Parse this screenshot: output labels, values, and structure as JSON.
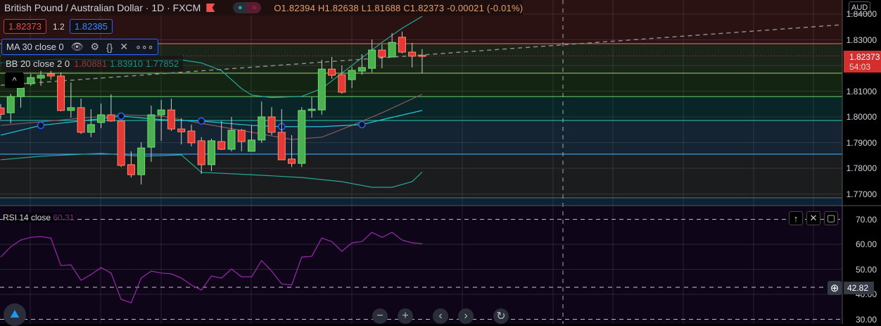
{
  "header": {
    "symbol": "British Pound / Australian Dollar · 1D · FXCM",
    "open": "O1.82394",
    "high": "H1.82638",
    "low": "L1.81688",
    "close": "C1.82373",
    "change": "-0.00021 (-0.01%)"
  },
  "quote": {
    "sell": "1.82373",
    "spread": "1.2",
    "buy": "1.82385"
  },
  "ma_legend": {
    "label": "MA 30 close 0"
  },
  "bb_legend": {
    "label": "BB 20 close 2 0",
    "basis": "1.80881",
    "upper": "1.83910",
    "lower": "1.77852"
  },
  "rsi_legend": {
    "label": "RSI 14 close",
    "value": "60.31"
  },
  "axis": {
    "currency": "AUD",
    "price_ticks": [
      "1.84000",
      "1.83000",
      "1.82000",
      "1.81000",
      "1.80000",
      "1.79000",
      "1.78000",
      "1.77000"
    ],
    "last_price": "1.82373",
    "countdown": "54:03",
    "rsi_ticks": [
      "70.00",
      "60.00",
      "50.00",
      "40.00",
      "30.00"
    ],
    "crosshair_rsi": "42.82"
  },
  "colors": {
    "up": "#4caf50",
    "down": "#e53935",
    "ma": "#26c6da",
    "bb": "#26a69a",
    "basis": "#8d5a5a",
    "rsi": "#9c27b0"
  },
  "chart_data": {
    "type": "candlestick",
    "ohlc": [
      [
        1.8035,
        1.805,
        1.799,
        1.801
      ],
      [
        1.8016,
        1.809,
        1.7975,
        1.8079
      ],
      [
        1.8079,
        1.8121,
        1.8036,
        1.8112
      ],
      [
        1.8129,
        1.8167,
        1.8121,
        1.8153
      ],
      [
        1.8151,
        1.8181,
        1.8121,
        1.8162
      ],
      [
        1.8167,
        1.8181,
        1.8145,
        1.8159
      ],
      [
        1.8159,
        1.8173,
        1.8022,
        1.8025
      ],
      [
        1.8025,
        1.8134,
        1.7997,
        1.8036
      ],
      [
        1.8036,
        1.8071,
        1.7934,
        1.794
      ],
      [
        1.794,
        1.803,
        1.7921,
        1.797
      ],
      [
        1.7978,
        1.8052,
        1.7956,
        1.8008
      ],
      [
        1.8008,
        1.8088,
        1.7981,
        1.7984
      ],
      [
        1.7984,
        1.7986,
        1.7805,
        1.7811
      ],
      [
        1.7814,
        1.7866,
        1.7764,
        1.7775
      ],
      [
        1.7775,
        1.7901,
        1.7737,
        1.7879
      ],
      [
        1.7882,
        1.8044,
        1.7825,
        1.8008
      ],
      [
        1.8008,
        1.8066,
        1.7907,
        1.8027
      ],
      [
        1.8027,
        1.8071,
        1.7945,
        1.7953
      ],
      [
        1.7953,
        1.7995,
        1.7893,
        1.7942
      ],
      [
        1.7945,
        1.797,
        1.7885,
        1.7899
      ],
      [
        1.7907,
        1.7921,
        1.7778,
        1.7814
      ],
      [
        1.7814,
        1.7915,
        1.7789,
        1.7907
      ],
      [
        1.7904,
        1.7984,
        1.7871,
        1.7874
      ],
      [
        1.7874,
        1.8,
        1.7866,
        1.7948
      ],
      [
        1.7948,
        1.7953,
        1.7866,
        1.7904
      ],
      [
        1.7866,
        1.7967,
        1.7866,
        1.791
      ],
      [
        1.791,
        1.806,
        1.7899,
        1.8
      ],
      [
        1.8,
        1.8038,
        1.7929,
        1.794
      ],
      [
        1.794,
        1.803,
        1.7833,
        1.7833
      ],
      [
        1.7836,
        1.7929,
        1.7805,
        1.7819
      ],
      [
        1.7819,
        1.8038,
        1.7805,
        1.8025
      ],
      [
        1.8025,
        1.8077,
        1.7997,
        1.803
      ],
      [
        1.8027,
        1.8222,
        1.8008,
        1.8186
      ],
      [
        1.8186,
        1.8233,
        1.8148,
        1.8162
      ],
      [
        1.8164,
        1.82,
        1.809,
        1.8096
      ],
      [
        1.8145,
        1.8195,
        1.8112,
        1.8181
      ],
      [
        1.8178,
        1.8244,
        1.8164,
        1.8192
      ],
      [
        1.8189,
        1.8301,
        1.8173,
        1.826
      ],
      [
        1.826,
        1.8282,
        1.8189,
        1.8233
      ],
      [
        1.8233,
        1.8326,
        1.8233,
        1.829
      ],
      [
        1.831,
        1.8332,
        1.8247,
        1.8252
      ],
      [
        1.8252,
        1.8288,
        1.8192,
        1.8236
      ],
      [
        1.82394,
        1.82638,
        1.81688,
        1.82373
      ]
    ],
    "bb_upper": [
      [
        0,
        1.821
      ],
      [
        6,
        1.8225
      ],
      [
        12,
        1.822
      ],
      [
        18,
        1.8222
      ],
      [
        20,
        1.821
      ],
      [
        22,
        1.818
      ],
      [
        24,
        1.811
      ],
      [
        25,
        1.8085
      ],
      [
        27,
        1.8075
      ],
      [
        30,
        1.808
      ],
      [
        32,
        1.811
      ],
      [
        34,
        1.817
      ],
      [
        36,
        1.823
      ],
      [
        38,
        1.829
      ],
      [
        40,
        1.8345
      ],
      [
        42,
        1.8391
      ]
    ],
    "bb_lower": [
      [
        0,
        1.7833
      ],
      [
        4,
        1.7847
      ],
      [
        10,
        1.7858
      ],
      [
        14,
        1.7847
      ],
      [
        18,
        1.7852
      ],
      [
        20,
        1.7784
      ],
      [
        25,
        1.7775
      ],
      [
        30,
        1.7764
      ],
      [
        34,
        1.7748
      ],
      [
        37,
        1.7726
      ],
      [
        39,
        1.7726
      ],
      [
        41,
        1.7748
      ],
      [
        42,
        1.7785
      ]
    ],
    "bb_basis": [
      [
        0,
        1.7967
      ],
      [
        8,
        1.7995
      ],
      [
        12,
        1.8008
      ],
      [
        16,
        1.8003
      ],
      [
        20,
        1.7975
      ],
      [
        25,
        1.794
      ],
      [
        29,
        1.7912
      ],
      [
        32,
        1.7921
      ],
      [
        35,
        1.7967
      ],
      [
        38,
        1.8016
      ],
      [
        42,
        1.8088
      ]
    ],
    "ma30": [
      [
        0,
        1.7929
      ],
      [
        4,
        1.7967
      ],
      [
        8,
        1.7984
      ],
      [
        12,
        1.8003
      ],
      [
        16,
        1.7989
      ],
      [
        20,
        1.7984
      ],
      [
        25,
        1.7967
      ],
      [
        28,
        1.7962
      ],
      [
        32,
        1.7962
      ],
      [
        36,
        1.797
      ],
      [
        38,
        1.7989
      ],
      [
        42,
        1.8025
      ]
    ],
    "ma_markers": [
      4,
      12,
      20,
      28,
      36
    ],
    "levels": [
      {
        "price": 1.8285,
        "color": "#e0584f"
      },
      {
        "price": 1.817,
        "color": "#8bc34a"
      },
      {
        "price": 1.8079,
        "color": "#66bb6a"
      },
      {
        "price": 1.7986,
        "color": "#26a69a"
      },
      {
        "price": 1.7855,
        "color": "#42a5f5"
      },
      {
        "price": 1.7685,
        "color": "#555c66"
      }
    ],
    "trendline": [
      [
        0,
        1.8123
      ],
      [
        84,
        1.8359
      ]
    ],
    "rsi": [
      54.9,
      59,
      61.7,
      62.8,
      63.1,
      62.5,
      51.5,
      51.8,
      45.6,
      47.9,
      50.7,
      48.5,
      38,
      36.6,
      46.5,
      49.3,
      48.5,
      48.2,
      46.5,
      43.7,
      41.7,
      47.3,
      46.5,
      50.1,
      47,
      47,
      53.5,
      49.3,
      44.2,
      43.7,
      54.9,
      55.2,
      62.5,
      61.1,
      57.2,
      60.6,
      61.1,
      64.8,
      62.8,
      64.8,
      61.7,
      60.6,
      60.3
    ],
    "rsi_bands": [
      70,
      30
    ],
    "price_range": [
      1.765,
      1.845
    ],
    "rsi_range": [
      30,
      70
    ]
  }
}
